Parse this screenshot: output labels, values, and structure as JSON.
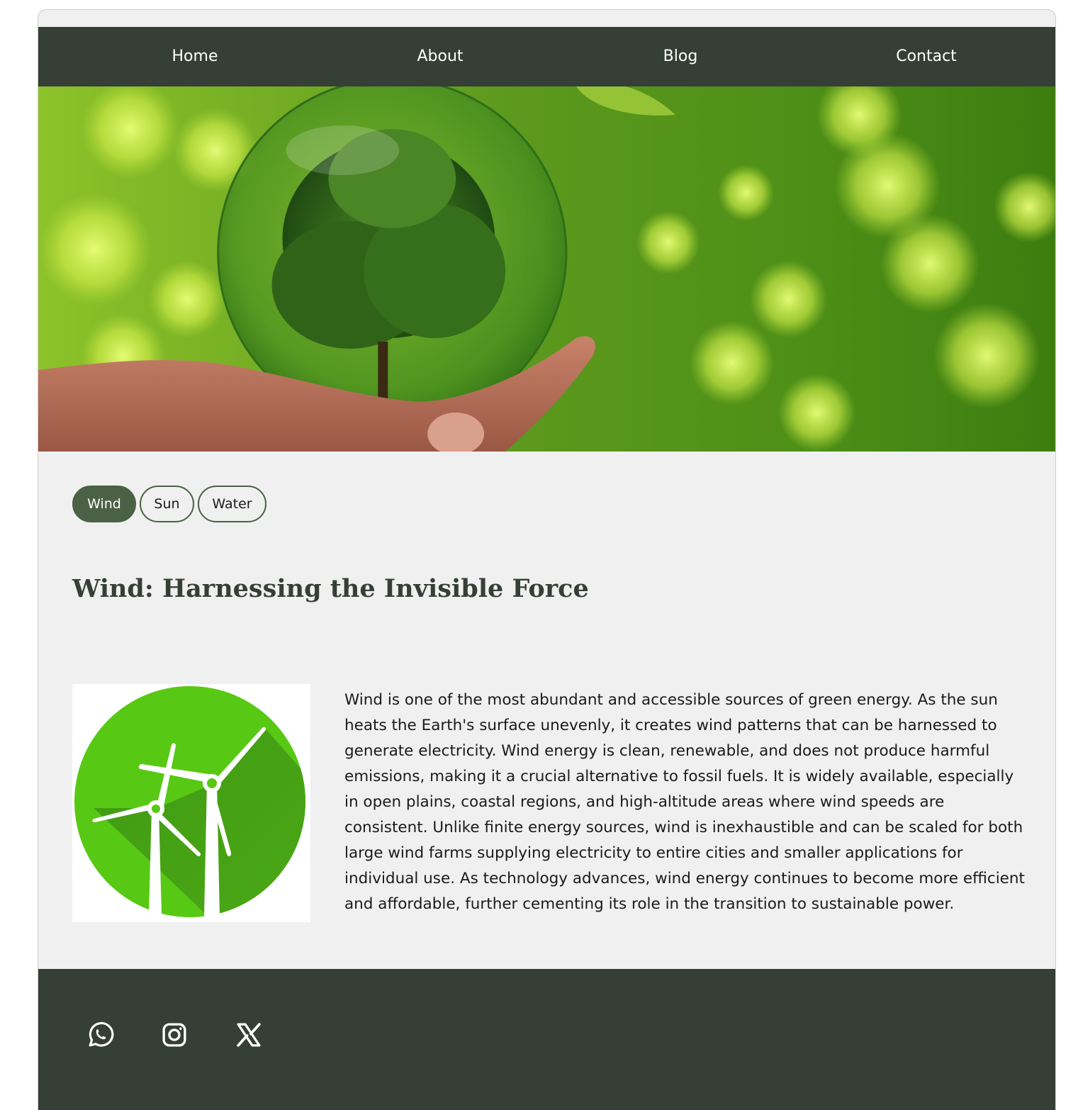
{
  "nav": {
    "items": [
      {
        "label": "Home"
      },
      {
        "label": "About"
      },
      {
        "label": "Blog"
      },
      {
        "label": "Contact"
      }
    ]
  },
  "hero": {
    "icon": "hero-image-hand-holding-glass-globe-with-tree"
  },
  "tabs": [
    {
      "label": "Wind",
      "active": true
    },
    {
      "label": "Sun",
      "active": false
    },
    {
      "label": "Water",
      "active": false
    }
  ],
  "article": {
    "title": "Wind: Harnessing the Invisible Force",
    "image_icon": "wind-turbine-icon",
    "body": "Wind is one of the most abundant and accessible sources of green energy. As the sun heats the Earth's surface unevenly, it creates wind patterns that can be harnessed to generate electricity. Wind energy is clean, renewable, and does not produce harmful emissions, making it a crucial alternative to fossil fuels. It is widely available, especially in open plains, coastal regions, and high-altitude areas where wind speeds are consistent. Unlike finite energy sources, wind is inexhaustible and can be scaled for both large wind farms supplying electricity to entire cities and smaller applications for individual use. As technology advances, wind energy continues to become more efficient and affordable, further cementing its role in the transition to sustainable power."
  },
  "footer": {
    "social": [
      {
        "icon": "whatsapp-icon"
      },
      {
        "icon": "instagram-icon"
      },
      {
        "icon": "x-twitter-icon"
      }
    ]
  },
  "colors": {
    "nav_bg": "#363f36",
    "accent": "#4a6145",
    "page_bg": "#f0f0f0",
    "turbine_green": "#57c914"
  }
}
